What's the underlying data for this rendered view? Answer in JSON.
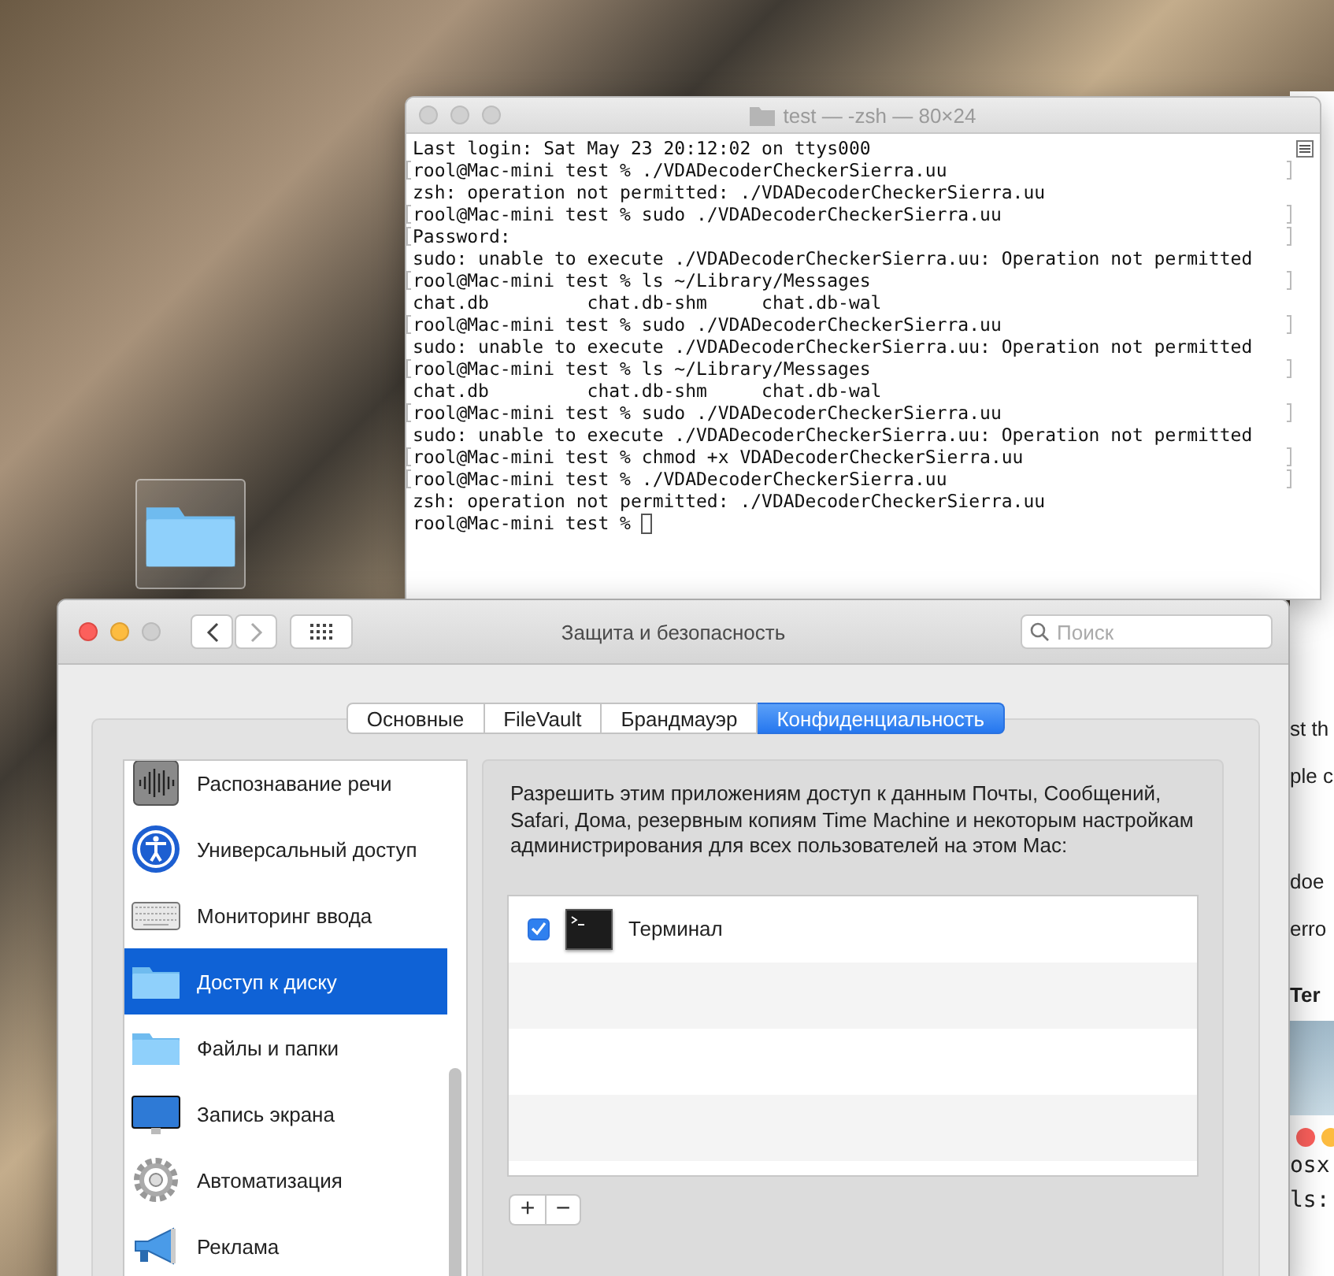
{
  "terminal": {
    "title": "test — -zsh — 80×24",
    "cursor": true,
    "lines": [
      {
        "text": "Last login: Sat May 23 20:12:02 on ttys000",
        "marked": false
      },
      {
        "text": "rool@Mac-mini test % ./VDADecoderCheckerSierra.uu",
        "marked": true
      },
      {
        "text": "zsh: operation not permitted: ./VDADecoderCheckerSierra.uu",
        "marked": false
      },
      {
        "text": "rool@Mac-mini test % sudo ./VDADecoderCheckerSierra.uu",
        "marked": true
      },
      {
        "text": "Password:",
        "marked": true
      },
      {
        "text": "sudo: unable to execute ./VDADecoderCheckerSierra.uu: Operation not permitted",
        "marked": false
      },
      {
        "text": "rool@Mac-mini test % ls ~/Library/Messages",
        "marked": true
      },
      {
        "text": "chat.db         chat.db-shm     chat.db-wal",
        "marked": false
      },
      {
        "text": "rool@Mac-mini test % sudo ./VDADecoderCheckerSierra.uu",
        "marked": true
      },
      {
        "text": "sudo: unable to execute ./VDADecoderCheckerSierra.uu: Operation not permitted",
        "marked": false
      },
      {
        "text": "rool@Mac-mini test % ls ~/Library/Messages",
        "marked": true
      },
      {
        "text": "chat.db         chat.db-shm     chat.db-wal",
        "marked": false
      },
      {
        "text": "rool@Mac-mini test % sudo ./VDADecoderCheckerSierra.uu",
        "marked": true
      },
      {
        "text": "sudo: unable to execute ./VDADecoderCheckerSierra.uu: Operation not permitted",
        "marked": false
      },
      {
        "text": "rool@Mac-mini test % chmod +x VDADecoderCheckerSierra.uu",
        "marked": true
      },
      {
        "text": "rool@Mac-mini test % ./VDADecoderCheckerSierra.uu",
        "marked": true
      },
      {
        "text": "zsh: operation not permitted: ./VDADecoderCheckerSierra.uu",
        "marked": false
      },
      {
        "text": "rool@Mac-mini test % ",
        "marked": false
      }
    ]
  },
  "background_window": {
    "fragments": [
      {
        "kind": "text",
        "text": "st th"
      },
      {
        "kind": "text",
        "text": "ple c"
      },
      {
        "kind": "text",
        "text": "doe"
      },
      {
        "kind": "text",
        "text": "erro"
      },
      {
        "kind": "heading",
        "text": "Ter"
      },
      {
        "kind": "image"
      },
      {
        "kind": "dots"
      },
      {
        "kind": "mono",
        "text": "osx"
      },
      {
        "kind": "mono",
        "text": "ls:"
      }
    ]
  },
  "preferences": {
    "title": "Защита и безопасность",
    "search": {
      "placeholder": "Поиск"
    },
    "tabs": [
      {
        "label": "Основные",
        "selected": false
      },
      {
        "label": "FileVault",
        "selected": false
      },
      {
        "label": "Брандмауэр",
        "selected": false
      },
      {
        "label": "Конфиденциальность",
        "selected": true
      }
    ],
    "sidebar": {
      "items": [
        {
          "label": "Распознавание речи",
          "kind": "waveform",
          "selected": false
        },
        {
          "label": "Универсальный доступ",
          "kind": "accessibility",
          "selected": false
        },
        {
          "label": "Мониторинг ввода",
          "kind": "keyboard",
          "selected": false
        },
        {
          "label": "Доступ к диску",
          "kind": "folder",
          "selected": true
        },
        {
          "label": "Файлы и папки",
          "kind": "folder",
          "selected": false
        },
        {
          "label": "Запись экрана",
          "kind": "display",
          "selected": false
        },
        {
          "label": "Автоматизация",
          "kind": "gear",
          "selected": false
        },
        {
          "label": "Реклама",
          "kind": "megaphone",
          "selected": false
        }
      ]
    },
    "description": "Разрешить этим приложениям доступ к данным Почты, Сообщений, Safari, Дома, резервным копиям Time Machine и некоторым настройкам администрирования для всех пользователей на этом Mac:",
    "apps": [
      {
        "name": "Терминал",
        "checked": true
      }
    ],
    "buttons": [
      "+",
      "−"
    ]
  }
}
